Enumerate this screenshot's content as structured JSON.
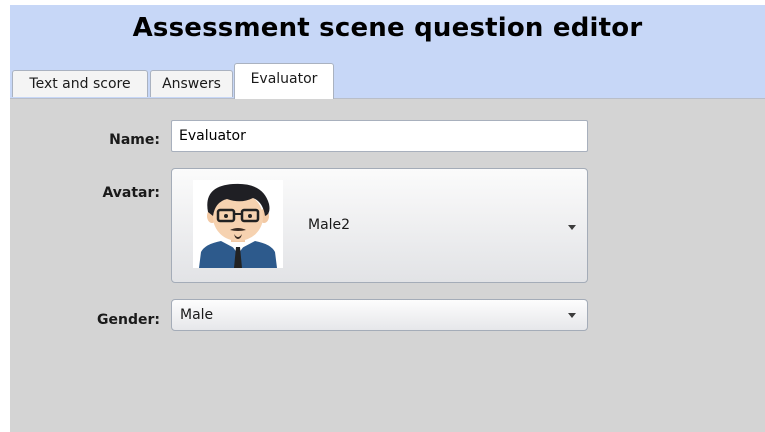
{
  "header": {
    "title": "Assessment scene question editor"
  },
  "tabs": [
    {
      "label": "Text and score",
      "active": false
    },
    {
      "label": "Answers",
      "active": false
    },
    {
      "label": "Evaluator",
      "active": true
    }
  ],
  "form": {
    "name": {
      "label": "Name:",
      "value": "Evaluator"
    },
    "avatar": {
      "label": "Avatar:",
      "selected": "Male2",
      "image_icon": "cartoon-male-avatar-glasses-goatee"
    },
    "gender": {
      "label": "Gender:",
      "selected": "Male"
    }
  },
  "colors": {
    "header_background": "#c7d7f7",
    "content_background": "#d4d4d4",
    "active_tab": "#ffffff"
  }
}
